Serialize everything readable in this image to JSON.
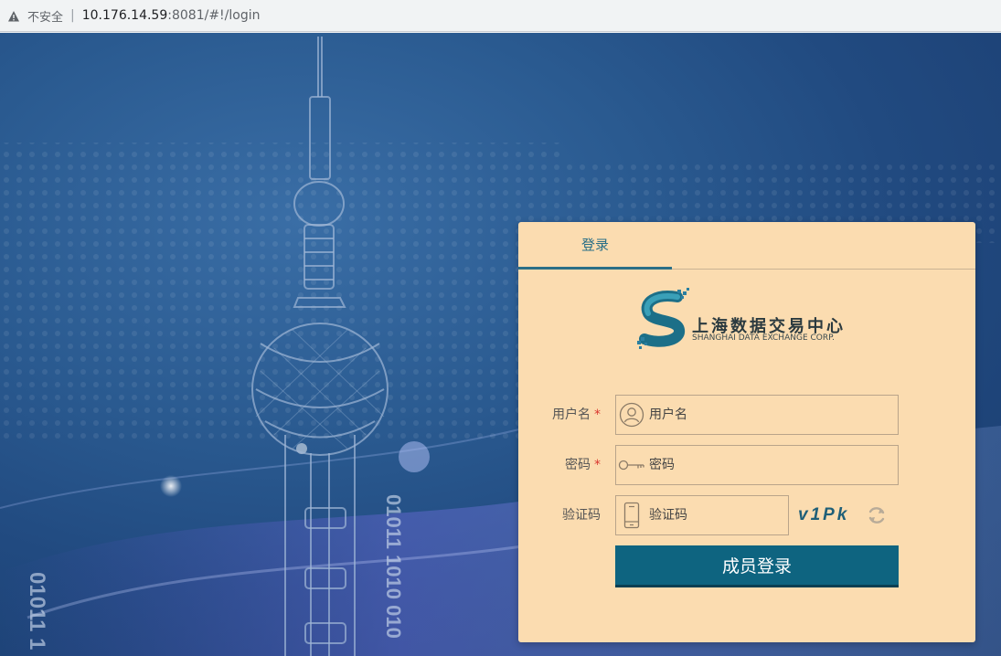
{
  "browser": {
    "security_label": "不安全",
    "url_host": "10.176.14.59",
    "url_rest": ":8081/#!/login"
  },
  "background": {
    "binary_text_1": "01011 1010 010",
    "binary_text_2": "01011 1"
  },
  "login": {
    "tab_label": "登录",
    "logo": {
      "name_cn": "上海数据交易中心",
      "name_en": "SHANGHAI DATA EXCHANGE CORP."
    },
    "username": {
      "label": "用户名",
      "required_mark": "*",
      "placeholder": "用户名",
      "icon": "user-icon"
    },
    "password": {
      "label": "密码",
      "required_mark": "*",
      "placeholder": "密码",
      "icon": "key-icon"
    },
    "captcha": {
      "label": "验证码",
      "placeholder": "验证码",
      "code": "v1Pk",
      "icon": "phone-icon",
      "refresh_icon": "refresh-icon"
    },
    "submit_label": "成员登录"
  },
  "colors": {
    "card_bg": "#fbdcb0",
    "accent": "#0e6480",
    "required": "#d9352e"
  }
}
